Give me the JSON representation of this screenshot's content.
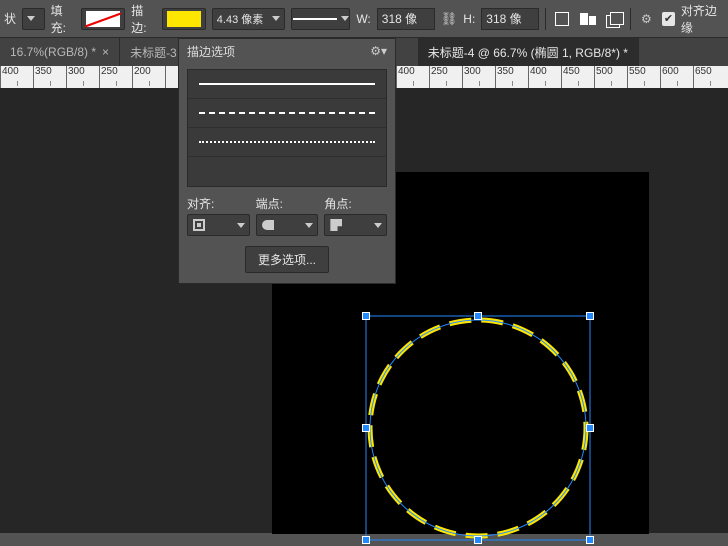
{
  "optbar": {
    "shape_label": "状",
    "fill_label": "填充:",
    "stroke_label": "描边:",
    "stroke_width": "4.43 像素",
    "w_label": "W:",
    "w_value": "318 像",
    "h_label": "H:",
    "h_value": "318 像",
    "align_edges_label": "对齐边缘"
  },
  "tabs": {
    "t1": "16.7%(RGB/8) *",
    "t2": "未标题-3",
    "t3": "未标题-4 @ 66.7% (椭圆 1, RGB/8*) *"
  },
  "ruler_ticks": [
    "400",
    "350",
    "300",
    "250",
    "200",
    "",
    "",
    "",
    "",
    "",
    "",
    "",
    "400",
    "250",
    "300",
    "350",
    "400",
    "450",
    "500",
    "550",
    "600",
    "650"
  ],
  "popover": {
    "title": "描边选项",
    "align_label": "对齐:",
    "caps_label": "端点:",
    "corners_label": "角点:",
    "more_btn": "更多选项..."
  },
  "colors": {
    "stroke": "#ffe600",
    "selection": "#2389ff"
  }
}
